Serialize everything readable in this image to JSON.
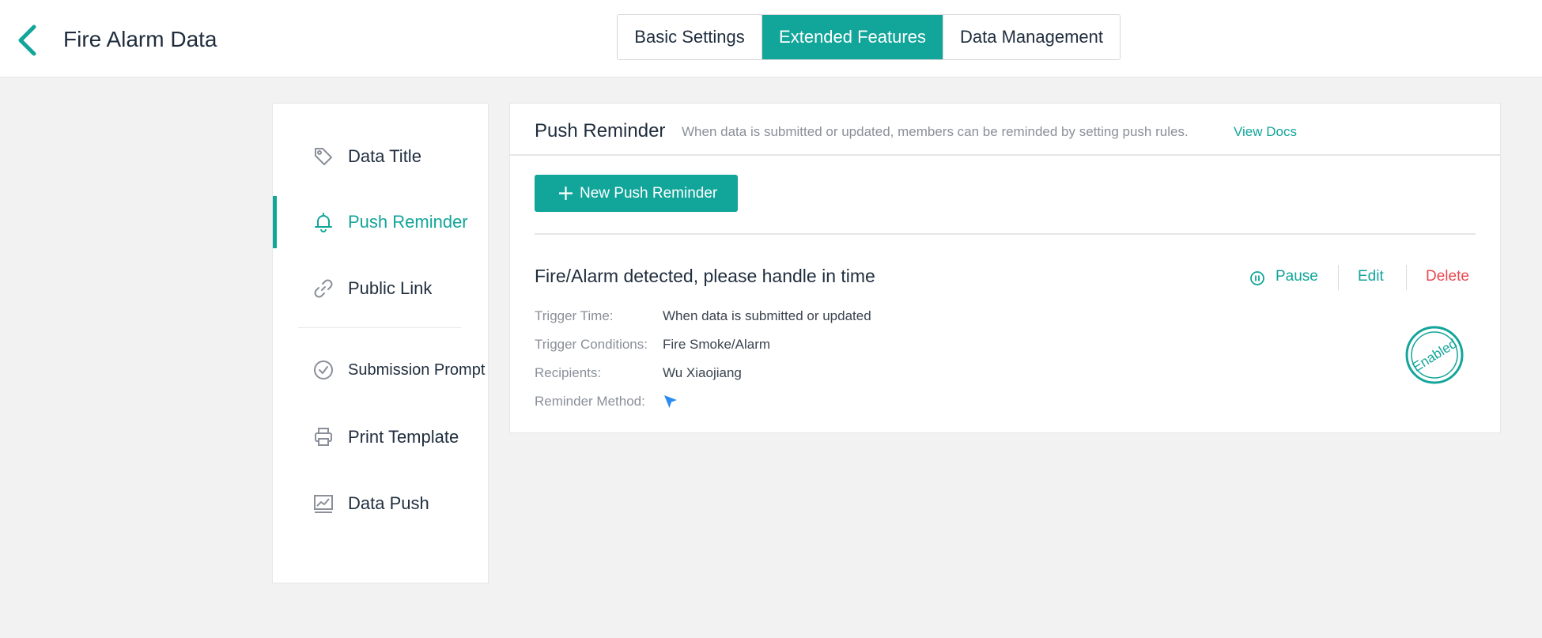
{
  "app": {
    "title": "Fire Alarm Data"
  },
  "tabs": [
    {
      "label": "Basic Settings",
      "active": false
    },
    {
      "label": "Extended Features",
      "active": true
    },
    {
      "label": "Data Management",
      "active": false
    }
  ],
  "sidebar": {
    "items": [
      {
        "label": "Data Title",
        "icon": "tag-icon",
        "active": false
      },
      {
        "label": "Push Reminder",
        "icon": "bell-icon",
        "active": true
      },
      {
        "label": "Public Link",
        "icon": "link-icon",
        "active": false
      },
      {
        "label": "Submission Prompt",
        "icon": "check-circle-icon",
        "active": false
      },
      {
        "label": "Print Template",
        "icon": "printer-icon",
        "active": false
      },
      {
        "label": "Data Push",
        "icon": "chart-line-icon",
        "active": false
      }
    ]
  },
  "main": {
    "title": "Push Reminder",
    "description": "When data is submitted or updated, members can be reminded by setting push rules.",
    "docs_link": "View Docs",
    "new_button": "New Push Reminder",
    "rule": {
      "title": "Fire/Alarm detected, please handle in time",
      "actions": {
        "pause": "Pause",
        "edit": "Edit",
        "delete": "Delete"
      },
      "fields": [
        {
          "label": "Trigger Time:",
          "value": "When data is submitted or updated"
        },
        {
          "label": "Trigger Conditions:",
          "value": "Fire Smoke/Alarm"
        },
        {
          "label": "Recipients:",
          "value": "Wu Xiaojiang"
        },
        {
          "label": "Reminder Method:",
          "value": ""
        }
      ],
      "status_stamp": "Enabled",
      "method_icon": "send-arrow-icon"
    }
  },
  "colors": {
    "accent": "#12a59a",
    "danger": "#e8484f",
    "text": "#1f2d3d",
    "muted": "#8a8f99",
    "method_icon": "#2a8cf0"
  }
}
